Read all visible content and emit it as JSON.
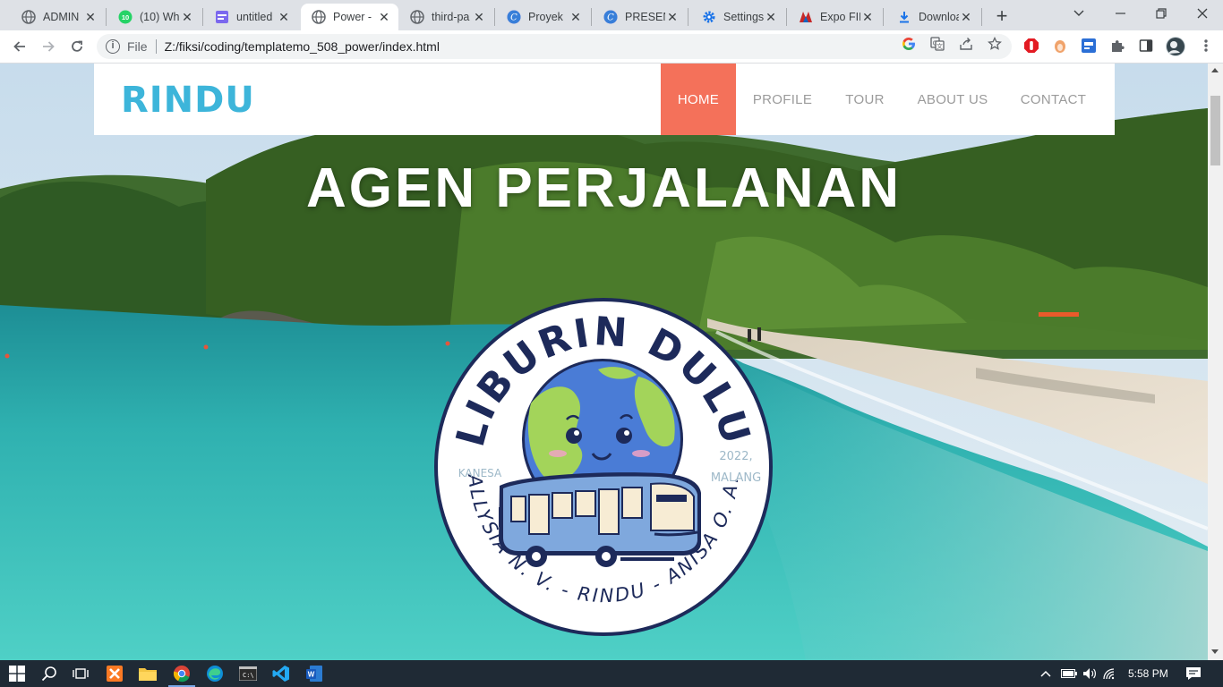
{
  "browser": {
    "tabs": [
      {
        "label": "ADMIN",
        "icon": "globe-icon",
        "active": false
      },
      {
        "label": "(10) Wh",
        "icon": "whatsapp-icon",
        "active": false
      },
      {
        "label": "untitled",
        "icon": "editor-icon",
        "active": false
      },
      {
        "label": "Power -",
        "icon": "globe-icon",
        "active": true
      },
      {
        "label": "third-pa",
        "icon": "globe-icon",
        "active": false
      },
      {
        "label": "Proyek",
        "icon": "canva-icon",
        "active": false
      },
      {
        "label": "PRESENT",
        "icon": "canva-icon",
        "active": false
      },
      {
        "label": "Settings",
        "icon": "gear-icon",
        "active": false
      },
      {
        "label": "Expo FIK",
        "icon": "expo-icon",
        "active": false
      },
      {
        "label": "Downloa",
        "icon": "download-icon",
        "active": false
      }
    ],
    "address": {
      "scheme": "File",
      "url": "Z:/fiksi/coding/templatemo_508_power/index.html"
    }
  },
  "page": {
    "brand": "RINDU",
    "menu": [
      {
        "label": "HOME",
        "active": true
      },
      {
        "label": "PROFILE",
        "active": false
      },
      {
        "label": "TOUR",
        "active": false
      },
      {
        "label": "ABOUT US",
        "active": false
      },
      {
        "label": "CONTACT",
        "active": false
      }
    ],
    "hero_title": "AGEN PERJALANAN",
    "logo": {
      "arc_top": "LIBURIN DULU",
      "arc_bottom": "ALLYSIA N. V. - RINDU - ANISA O. A.",
      "left_text": "KANESA",
      "right_text_1": "2022,",
      "right_text_2": "MALANG"
    },
    "colors": {
      "brand": "#3db5da",
      "active_menu": "#f4715a",
      "logo_navy": "#1d2a5a"
    }
  },
  "taskbar": {
    "time": "5:58 PM"
  }
}
